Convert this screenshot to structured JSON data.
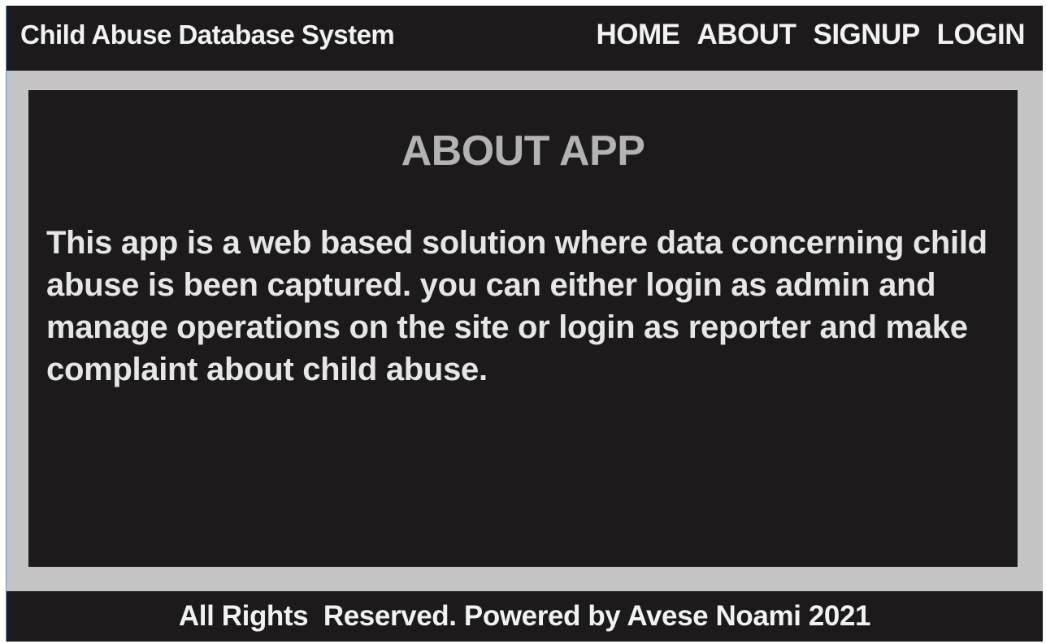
{
  "header": {
    "brand": "Child Abuse Database System",
    "nav": [
      {
        "label": "HOME"
      },
      {
        "label": "ABOUT"
      },
      {
        "label": "SIGNUP"
      },
      {
        "label": "LOGIN"
      }
    ]
  },
  "main": {
    "title": "ABOUT APP",
    "description": "This app is a web based solution where data concerning child abuse is been captured. you can either login as admin and manage operations on the site or login as reporter and make complaint about child abuse."
  },
  "footer": {
    "text": "All Rights  Reserved. Powered by Avese Noami 2021"
  },
  "colors": {
    "bar_background": "#1c1a1a",
    "page_background": "#c4c4c4",
    "title_color": "#b3b3b3",
    "text_color": "#e6e6e6"
  }
}
